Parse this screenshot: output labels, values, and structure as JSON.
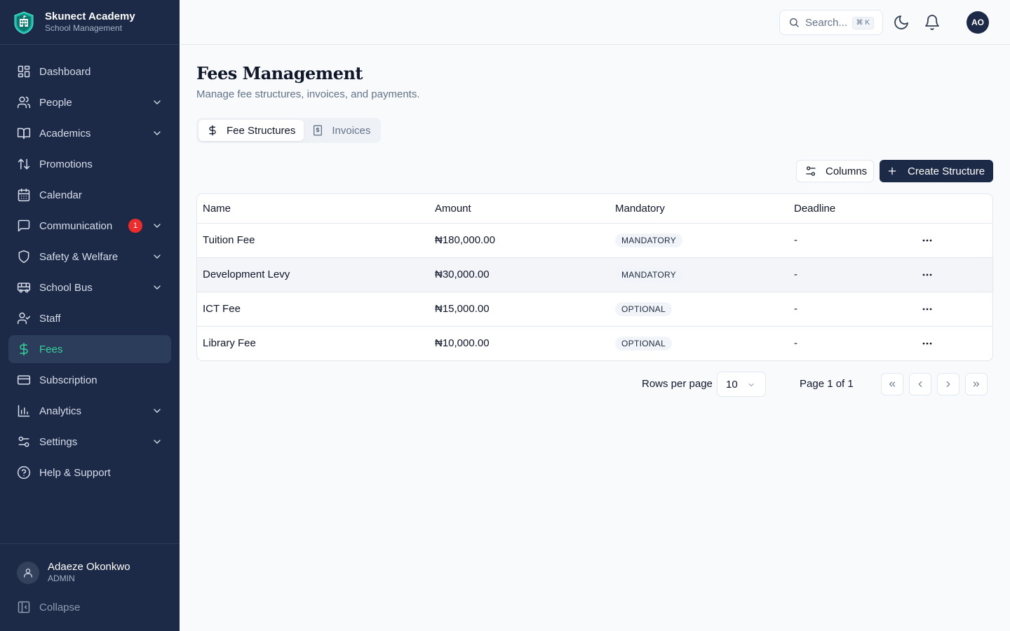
{
  "brand": {
    "name": "Skunect Academy",
    "subtitle": "School Management"
  },
  "sidebar": {
    "items": [
      {
        "label": "Dashboard",
        "icon": "dashboard-icon",
        "expandable": false
      },
      {
        "label": "People",
        "icon": "people-icon",
        "expandable": true
      },
      {
        "label": "Academics",
        "icon": "book-icon",
        "expandable": true
      },
      {
        "label": "Promotions",
        "icon": "arrows-up-down-icon",
        "expandable": false
      },
      {
        "label": "Calendar",
        "icon": "calendar-icon",
        "expandable": false
      },
      {
        "label": "Communication",
        "icon": "message-icon",
        "expandable": true,
        "badge": "1"
      },
      {
        "label": "Safety & Welfare",
        "icon": "shield-icon",
        "expandable": true
      },
      {
        "label": "School Bus",
        "icon": "bus-icon",
        "expandable": true
      },
      {
        "label": "Staff",
        "icon": "user-check-icon",
        "expandable": false
      },
      {
        "label": "Fees",
        "icon": "dollar-icon",
        "expandable": false,
        "active": true
      },
      {
        "label": "Subscription",
        "icon": "credit-card-icon",
        "expandable": false
      },
      {
        "label": "Analytics",
        "icon": "bar-chart-icon",
        "expandable": true
      },
      {
        "label": "Settings",
        "icon": "sliders-icon",
        "expandable": true
      },
      {
        "label": "Help & Support",
        "icon": "help-circle-icon",
        "expandable": false
      }
    ],
    "user": {
      "name": "Adaeze Okonkwo",
      "role": "ADMIN"
    },
    "collapse_label": "Collapse"
  },
  "topbar": {
    "search_placeholder": "Search...",
    "search_shortcut": "⌘ K",
    "avatar_initials": "AO"
  },
  "page": {
    "title": "Fees Management",
    "subtitle": "Manage fee structures, invoices, and payments.",
    "tabs": [
      {
        "label": "Fee Structures",
        "active": true
      },
      {
        "label": "Invoices",
        "active": false
      }
    ],
    "columns_button": "Columns",
    "create_button": "Create Structure"
  },
  "table": {
    "headers": [
      "Name",
      "Amount",
      "Mandatory",
      "Deadline"
    ],
    "rows": [
      {
        "name": "Tuition Fee",
        "amount": "₦180,000.00",
        "mandatory": "MANDATORY",
        "deadline": "-"
      },
      {
        "name": "Development Levy",
        "amount": "₦30,000.00",
        "mandatory": "MANDATORY",
        "deadline": "-"
      },
      {
        "name": "ICT Fee",
        "amount": "₦15,000.00",
        "mandatory": "OPTIONAL",
        "deadline": "-"
      },
      {
        "name": "Library Fee",
        "amount": "₦10,000.00",
        "mandatory": "OPTIONAL",
        "deadline": "-"
      }
    ]
  },
  "pagination": {
    "rows_per_page_label": "Rows per page",
    "rows_per_page_value": "10",
    "page_info": "Page 1 of 1"
  },
  "colors": {
    "sidebar_bg": "#1c2a47",
    "accent": "#34d399",
    "primary_button": "#1c2a47",
    "badge": "#ef2b2b"
  }
}
